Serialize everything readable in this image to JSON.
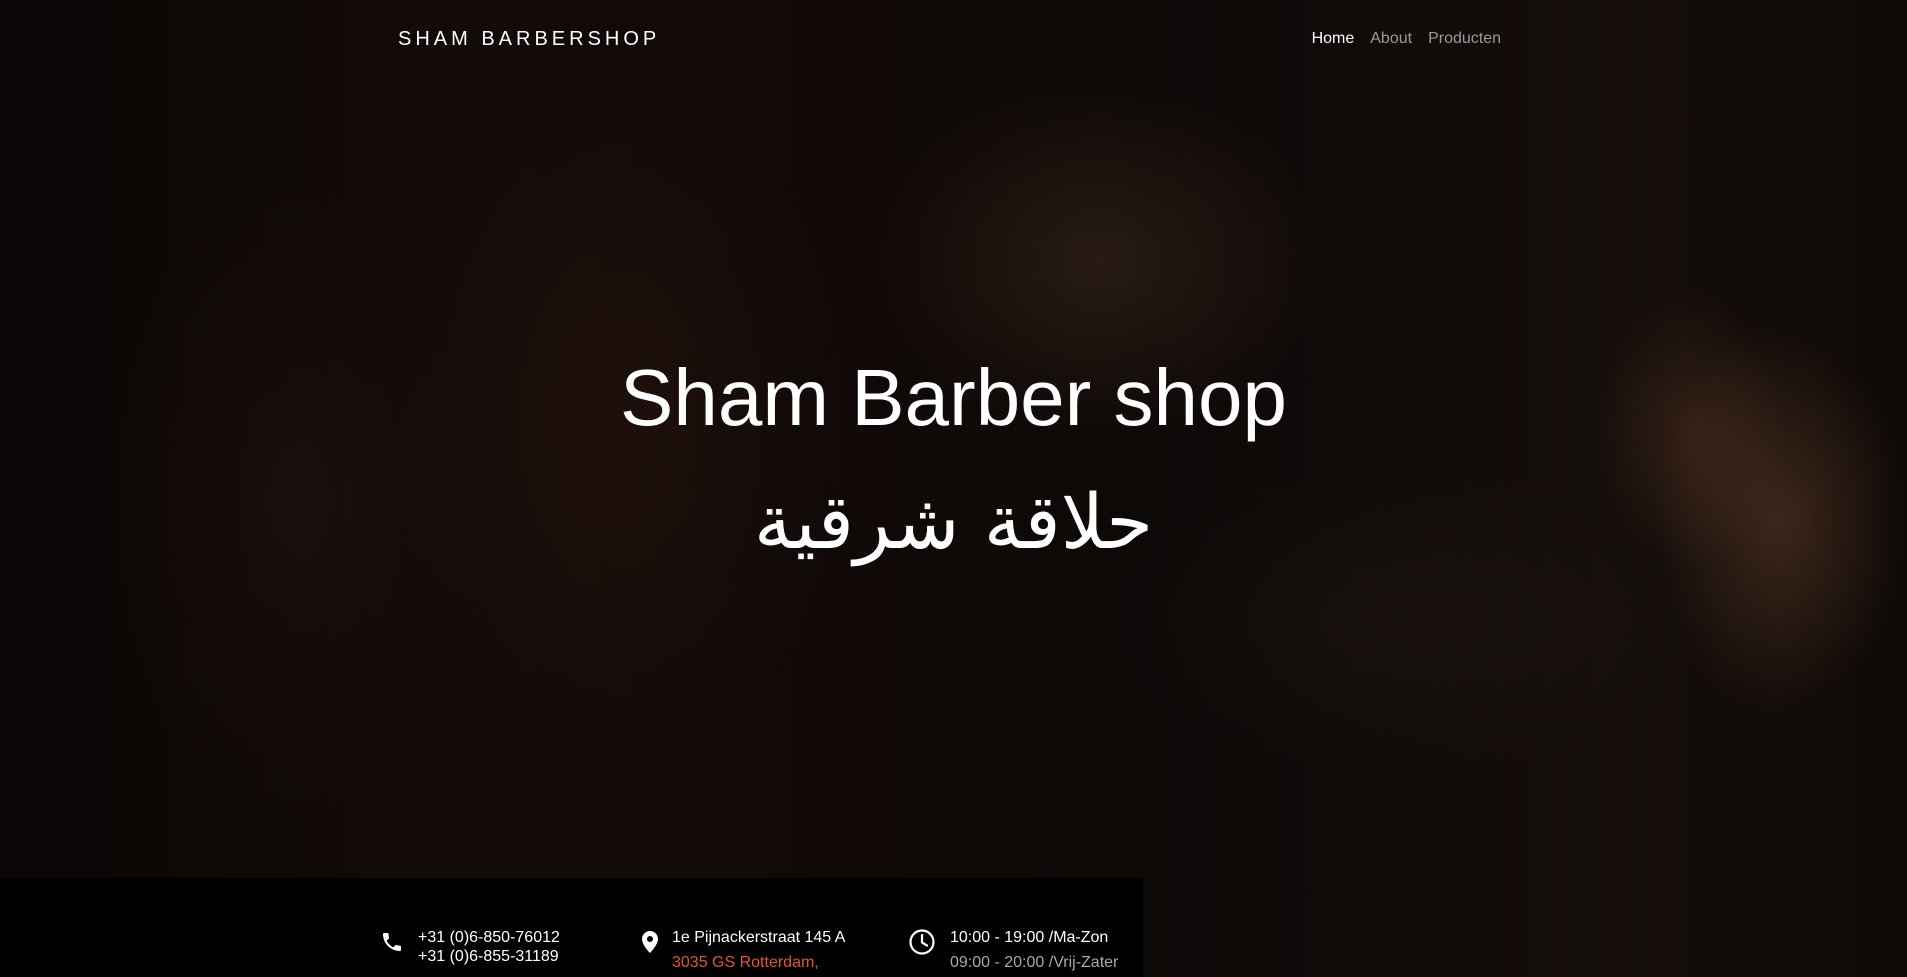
{
  "header": {
    "brand": "SHAM BARBERSHOP",
    "nav": [
      {
        "label": "Home",
        "active": true
      },
      {
        "label": "About",
        "active": false
      },
      {
        "label": "Producten",
        "active": false
      }
    ]
  },
  "hero": {
    "title": "Sham Barber shop",
    "subtitle_arabic": "حلاقة شرقية"
  },
  "info": {
    "phone": {
      "icon": "phone-icon",
      "line1": "+31 (0)6-850-76012",
      "line2": "+31 (0)6-855-31189"
    },
    "address": {
      "icon": "map-pin-icon",
      "line1": "1e Pijnackerstraat 145 A",
      "line2": "3035 GS Rotterdam,"
    },
    "hours": {
      "icon": "clock-icon",
      "line1": "10:00 - 19:00 /Ma-Zon",
      "line2": "09:00 - 20:00 /Vrij-Zater"
    }
  },
  "colors": {
    "accent_orange": "#e0572b",
    "nav_inactive": "#9a9a9a",
    "text_white": "#ffffff"
  }
}
